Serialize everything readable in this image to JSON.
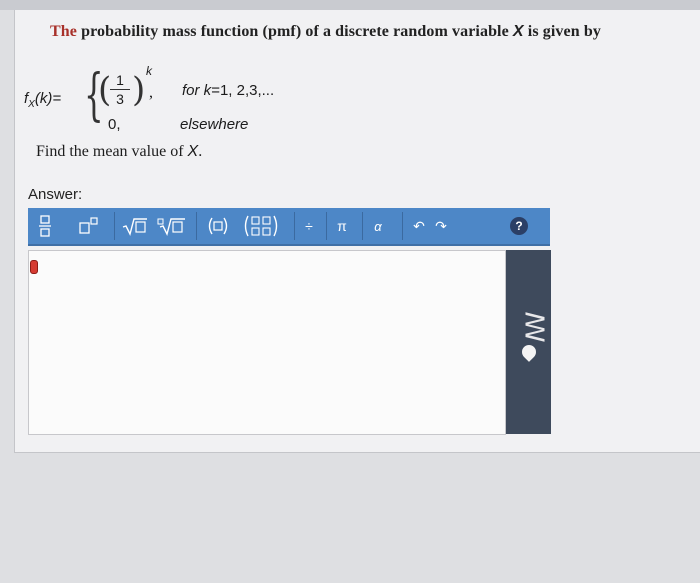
{
  "question": {
    "lead": "The",
    "text": " probability mass function (pmf) of a discrete random variable ",
    "var": "X",
    "tail": " is given by"
  },
  "pmf": {
    "lhs": "f",
    "lhs_sub": "X",
    "lhs_arg": "(k)=",
    "num": "1",
    "den": "3",
    "exp": "k",
    "comma": ",",
    "cond1_prefix": "for k",
    "cond1_values": "=1, 2,3,...",
    "zero": "0,",
    "cond2": "elsewhere"
  },
  "find": {
    "text": "Find the mean value of ",
    "var": "X",
    "end": "."
  },
  "answer": {
    "label": "Answer:"
  },
  "toolbar": {
    "buttons": [
      {
        "icon": "fraction-icon",
        "glyph": "□/□"
      },
      {
        "icon": "superscript-icon",
        "glyph": "□ᴰ"
      },
      {
        "icon": "sqrt-icon",
        "glyph": "√□"
      },
      {
        "icon": "nthroot-icon",
        "glyph": "∛□"
      },
      {
        "icon": "parentheses-icon",
        "glyph": "(□)"
      },
      {
        "icon": "matrix-icon",
        "glyph": "(□□/□□)"
      },
      {
        "icon": "plus-minus-icon",
        "glyph": "÷"
      },
      {
        "icon": "pi-icon",
        "glyph": "π"
      },
      {
        "icon": "alpha-icon",
        "glyph": "α"
      },
      {
        "icon": "undo-icon",
        "glyph": "↶"
      },
      {
        "icon": "redo-icon",
        "glyph": "↷"
      }
    ],
    "help": "?"
  },
  "colors": {
    "toolbar": "#4d87c7",
    "side_panel": "#3e4a5c",
    "accent_red": "#d63b32"
  }
}
